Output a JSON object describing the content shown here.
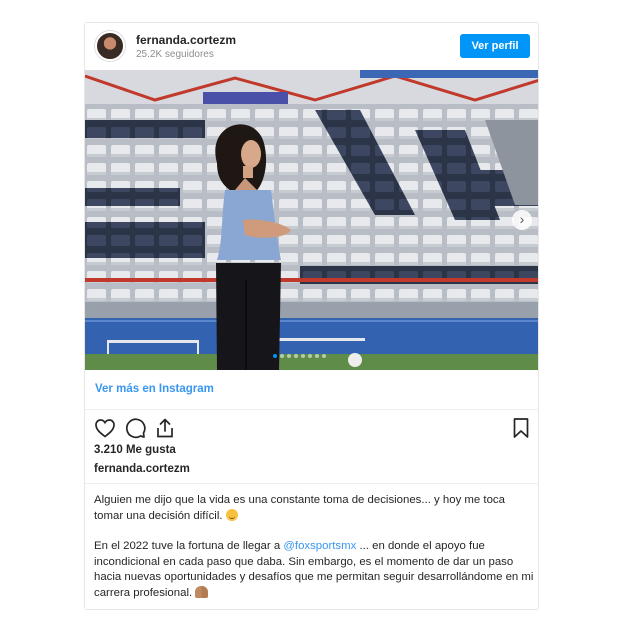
{
  "header": {
    "username": "fernanda.cortezm",
    "followers": "25.2K seguidores",
    "profile_button": "Ver perfil"
  },
  "post": {
    "carousel_count": 8,
    "carousel_active_index": 0
  },
  "view_more": "Ver más en Instagram",
  "actions": {
    "icons": [
      "heart-icon",
      "comment-icon",
      "share-icon",
      "bookmark-icon"
    ],
    "likes": "3.210 Me gusta"
  },
  "caption": {
    "username": "fernanda.cortezm",
    "p1": "Alguien me dijo que la vida es una constante toma de decisiones... y hoy me toca tomar una decisión difícil.",
    "p2_before": "En el 2022 tuve la fortuna de llegar a ",
    "mention": "@foxsportsmx",
    "p2_after": " ... en donde el apoyo fue incondicional en cada paso que daba. Sin embargo, es el momento de dar un paso hacia nuevas oportunidades y desafíos que me permitan seguir desarrollándome en mi carrera profesional."
  },
  "colors": {
    "accent": "#0095f6",
    "link": "#3897f0"
  }
}
